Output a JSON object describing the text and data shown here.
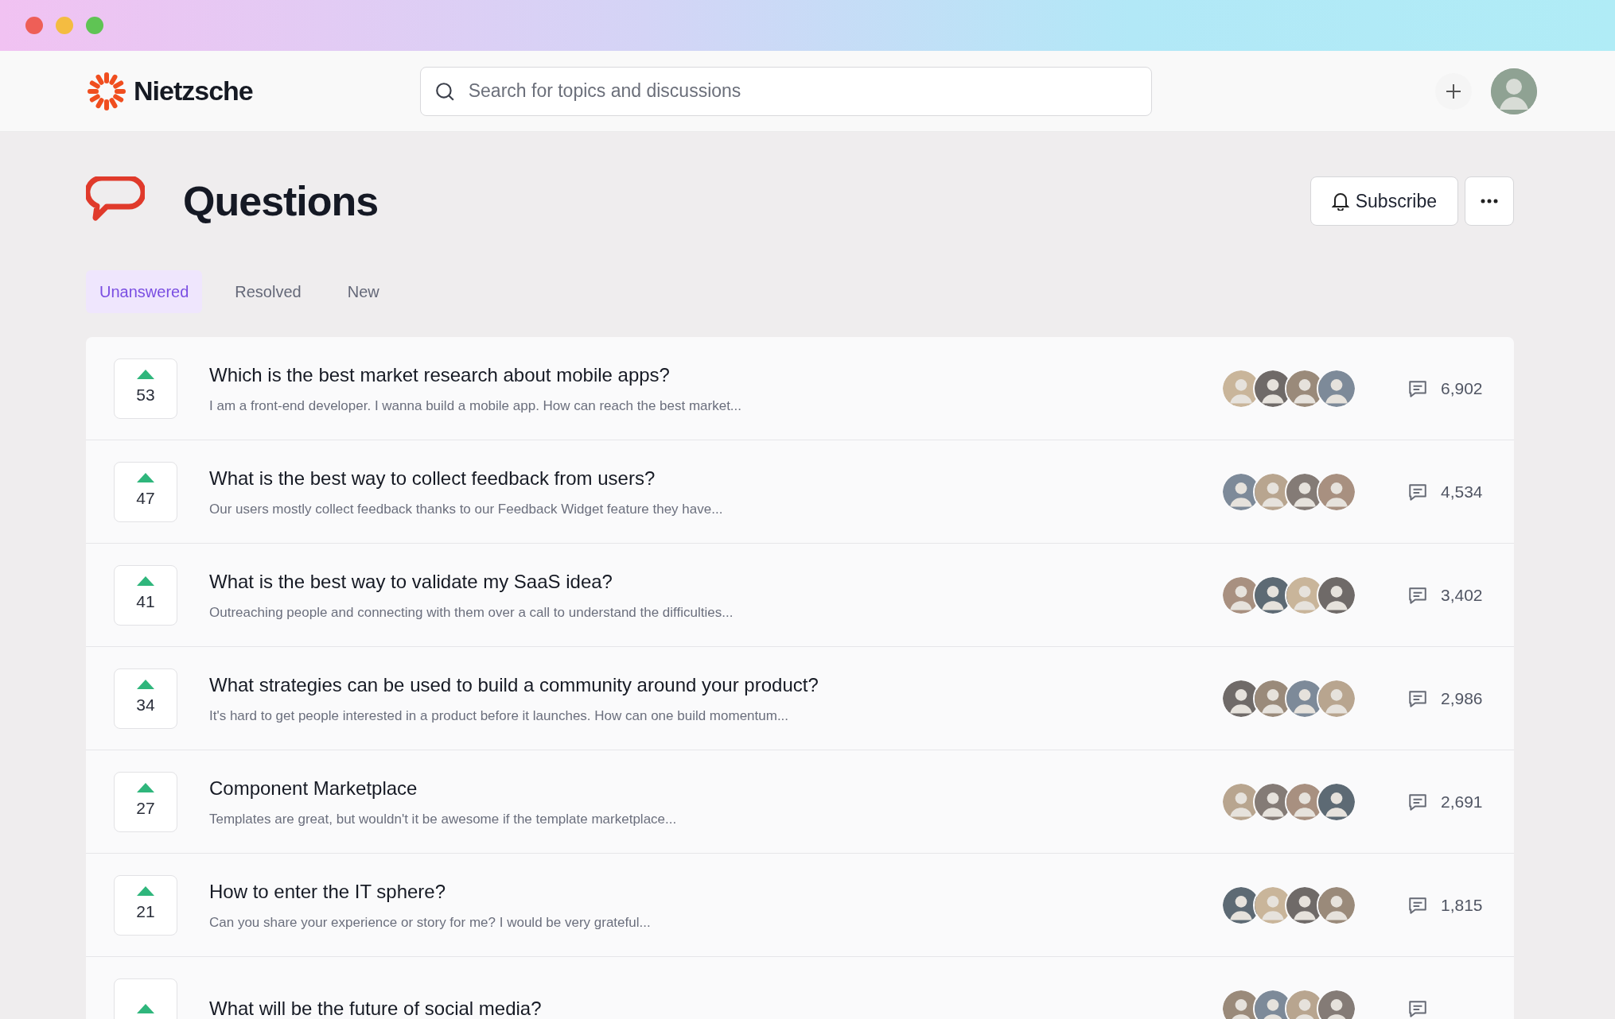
{
  "header": {
    "brand": "Nietzsche",
    "search": {
      "placeholder": "Search for topics and discussions"
    }
  },
  "page": {
    "title": "Questions",
    "subscribe": "Subscribe"
  },
  "tabs": [
    {
      "label": "Unanswered",
      "selected": true
    },
    {
      "label": "Resolved",
      "selected": false
    },
    {
      "label": "New",
      "selected": false
    }
  ],
  "questions": [
    {
      "votes": "53",
      "title": "Which is the best market research about mobile apps?",
      "excerpt": "I am a front-end developer. I wanna build a mobile app. How can reach the best market...",
      "comments": "6,902"
    },
    {
      "votes": "47",
      "title": "What is the best way to collect feedback from users?",
      "excerpt": "Our users mostly collect feedback thanks to our Feedback Widget feature they have...",
      "comments": "4,534"
    },
    {
      "votes": "41",
      "title": "What is the best way to validate my SaaS idea?",
      "excerpt": "Outreaching people and connecting with them over a call to understand the difficulties...",
      "comments": "3,402"
    },
    {
      "votes": "34",
      "title": "What strategies can be used to build a community around your product?",
      "excerpt": "It's hard to get people interested in a product before it launches. How can one build momentum...",
      "comments": "2,986"
    },
    {
      "votes": "27",
      "title": "Component Marketplace",
      "excerpt": "Templates are great, but wouldn't it be awesome if the template marketplace...",
      "comments": "2,691"
    },
    {
      "votes": "21",
      "title": "How to enter the IT sphere?",
      "excerpt": "Can you share your experience or story for me? I would be very grateful...",
      "comments": "1,815"
    },
    {
      "title": "What will be the future of social media?"
    }
  ]
}
